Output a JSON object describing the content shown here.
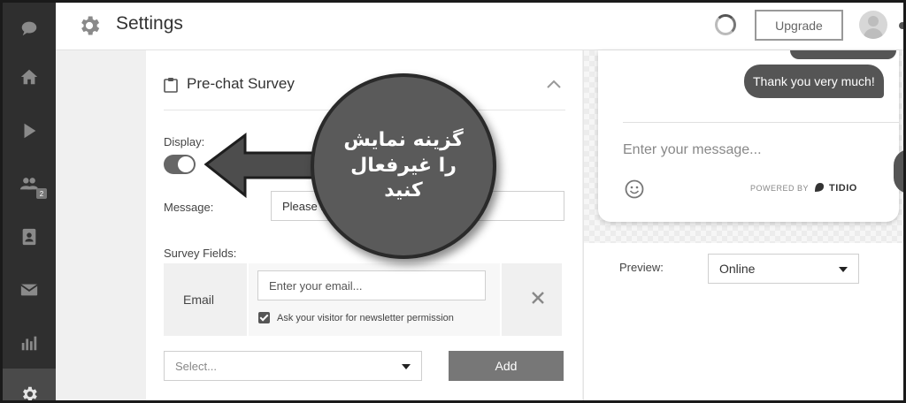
{
  "header": {
    "title": "Settings",
    "upgrade_label": "Upgrade"
  },
  "sidebar": {
    "items": [
      {
        "icon": "chat-bubble-icon"
      },
      {
        "icon": "home-icon"
      },
      {
        "icon": "play-icon"
      },
      {
        "icon": "visitors-icon",
        "badge": "2"
      },
      {
        "icon": "contacts-icon"
      },
      {
        "icon": "mail-icon"
      },
      {
        "icon": "analytics-icon"
      },
      {
        "icon": "gear-icon",
        "active": true
      }
    ]
  },
  "panel": {
    "title": "Pre-chat Survey",
    "display_label": "Display:",
    "display_enabled": true,
    "message_label": "Message:",
    "message_value": "Please introduce yourself:",
    "survey_fields_label": "Survey Fields:",
    "field": {
      "name": "Email",
      "placeholder": "Enter your email...",
      "checkbox_label": "Ask your visitor for newsletter permission",
      "checkbox_checked": true
    },
    "select_placeholder": "Select...",
    "add_label": "Add"
  },
  "preview": {
    "chat_message": "Thank you very much!",
    "input_placeholder": "Enter your message...",
    "powered_by": "POWERED BY",
    "brand": "TIDIO",
    "preview_label": "Preview:",
    "preview_value": "Online"
  },
  "annotation": {
    "text": "گزینه نمایش را غیرفعال کنید"
  },
  "colors": {
    "sidebar_bg": "#2f2f2f",
    "accent": "#555555",
    "annotation_bg": "#5a5a5a"
  }
}
